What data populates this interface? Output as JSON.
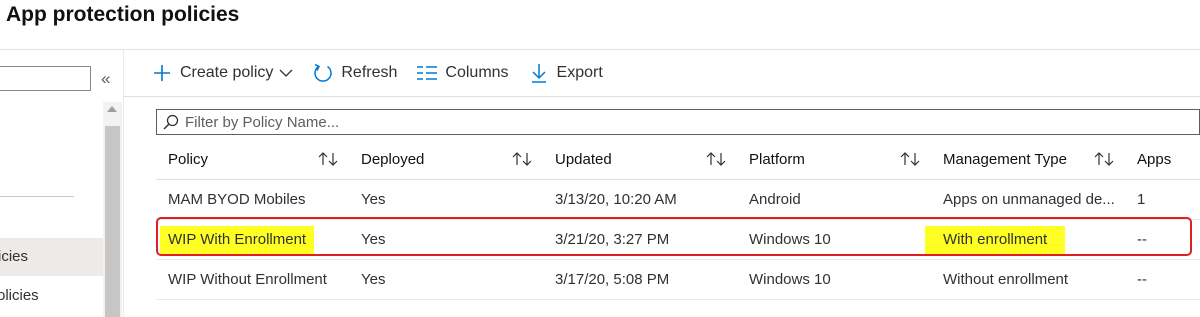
{
  "page": {
    "title": "App protection policies"
  },
  "left_nav": {
    "search_value": "",
    "collapse_glyph": "«",
    "items": [
      {
        "label": "icies",
        "selected": true
      },
      {
        "label": "olicies",
        "selected": false
      }
    ]
  },
  "toolbar": {
    "create_label": "Create policy",
    "refresh_label": "Refresh",
    "columns_label": "Columns",
    "export_label": "Export"
  },
  "filter": {
    "placeholder": "Filter by Policy Name...",
    "value": ""
  },
  "table": {
    "headers": [
      "Policy",
      "Deployed",
      "Updated",
      "Platform",
      "Management Type",
      "Apps"
    ],
    "rows": [
      {
        "policy": "MAM BYOD Mobiles",
        "deployed": "Yes",
        "updated": "3/13/20, 10:20 AM",
        "platform": "Android",
        "management": "Apps on unmanaged de...",
        "apps": "1"
      },
      {
        "policy": "WIP With Enrollment",
        "deployed": "Yes",
        "updated": "3/21/20, 3:27 PM",
        "platform": "Windows 10",
        "management": "With enrollment",
        "apps": "--"
      },
      {
        "policy": "WIP Without Enrollment",
        "deployed": "Yes",
        "updated": "3/17/20, 5:08 PM",
        "platform": "Windows 10",
        "management": "Without enrollment",
        "apps": "--"
      }
    ]
  },
  "colors": {
    "accent": "#0078d4",
    "highlight": "#ffff24",
    "outline": "#e02020"
  }
}
